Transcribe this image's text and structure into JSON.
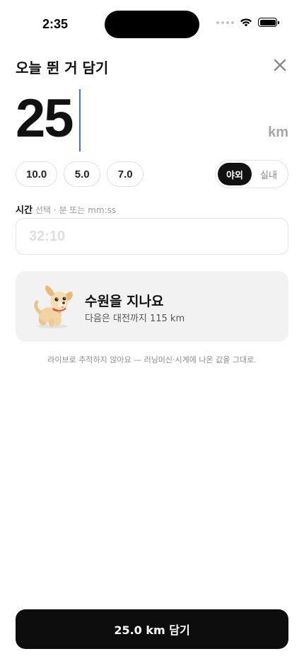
{
  "status_bar": {
    "time": "2:35",
    "icons": [
      "signal-dots-icon",
      "wifi-icon",
      "battery-icon"
    ]
  },
  "header": {
    "title": "오늘 뛴 거 담기",
    "close_icon": "close-icon"
  },
  "distance": {
    "value": "25",
    "unit": "km"
  },
  "presets": [
    "10.0",
    "5.0",
    "7.0"
  ],
  "mode": {
    "options": [
      "야외",
      "실내"
    ],
    "selected": "야외"
  },
  "time_field": {
    "label": "시간",
    "hint": "선택 · 분 또는 mm:ss",
    "value": "",
    "placeholder": "32:10"
  },
  "milestone": {
    "icon": "dog-icon",
    "title": "수원을 지나요",
    "subtitle": "다음은 대전까지 115 km"
  },
  "footnote": "라이브로 추적하지 않아요 — 러닝머신·시계에 나온 값을 그대로.",
  "save_button": {
    "label": "25.0 km 담기"
  },
  "colors": {
    "accent_caret": "#3b6fe0",
    "primary_dark": "#0d0d0d",
    "card_background": "#f2f2f2"
  }
}
